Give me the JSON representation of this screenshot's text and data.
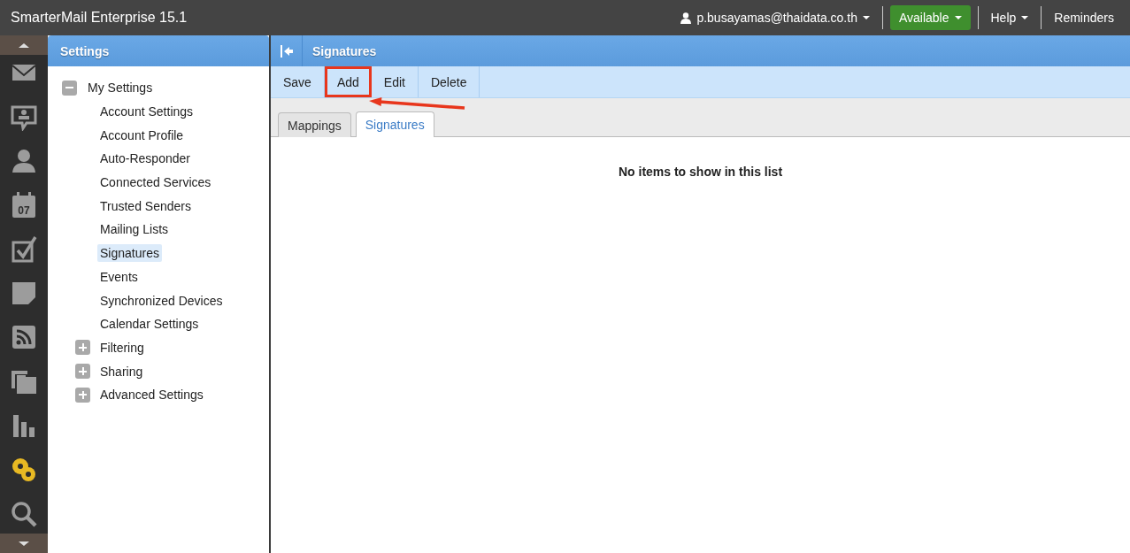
{
  "top_bar": {
    "app_title": "SmarterMail Enterprise 15.1",
    "user": "p.busayamas@thaidata.co.th",
    "status": "Available",
    "help": "Help",
    "reminders": "Reminders"
  },
  "rail": [
    {
      "kind": "mail",
      "selected": false
    },
    {
      "kind": "chat",
      "selected": false
    },
    {
      "kind": "contacts",
      "selected": false
    },
    {
      "kind": "calendar",
      "selected": false,
      "text": "07"
    },
    {
      "kind": "tasks",
      "selected": false
    },
    {
      "kind": "notes",
      "selected": false
    },
    {
      "kind": "feeds",
      "selected": false
    },
    {
      "kind": "files",
      "selected": false
    },
    {
      "kind": "reports",
      "selected": false
    },
    {
      "kind": "settings",
      "selected": true
    },
    {
      "kind": "search",
      "selected": false
    }
  ],
  "sidebar": {
    "title": "Settings",
    "tree": [
      {
        "label": "My Settings",
        "expanded": true,
        "selected": false,
        "children": [
          {
            "label": "Account Settings",
            "selected": false
          },
          {
            "label": "Account Profile",
            "selected": false
          },
          {
            "label": "Auto-Responder",
            "selected": false
          },
          {
            "label": "Connected Services",
            "selected": false
          },
          {
            "label": "Trusted Senders",
            "selected": false
          },
          {
            "label": "Mailing Lists",
            "selected": false
          },
          {
            "label": "Signatures",
            "selected": true
          },
          {
            "label": "Events",
            "selected": false
          },
          {
            "label": "Synchronized Devices",
            "selected": false
          },
          {
            "label": "Calendar Settings",
            "selected": false
          },
          {
            "label": "Filtering",
            "expanded": false,
            "selected": false
          },
          {
            "label": "Sharing",
            "expanded": false,
            "selected": false
          },
          {
            "label": "Advanced Settings",
            "expanded": false,
            "selected": false
          }
        ]
      }
    ]
  },
  "main": {
    "title": "Signatures",
    "toolbar": [
      {
        "label": "Save",
        "highlighted": false
      },
      {
        "label": "Add",
        "highlighted": true
      },
      {
        "label": "Edit",
        "highlighted": false
      },
      {
        "label": "Delete",
        "highlighted": false
      }
    ],
    "tabs": [
      {
        "label": "Mappings",
        "selected": false
      },
      {
        "label": "Signatures",
        "selected": true
      }
    ],
    "empty_message": "No items to show in this list"
  }
}
